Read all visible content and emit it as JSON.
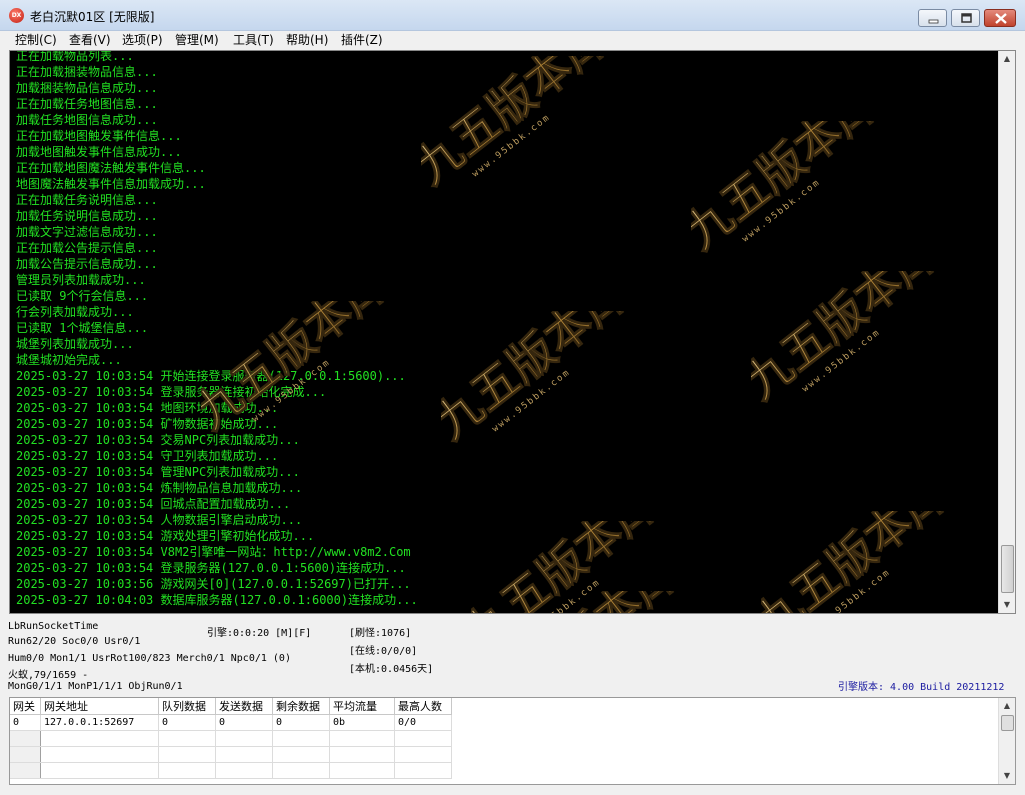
{
  "window": {
    "title": "老白沉默01区 [无限版]",
    "icon_text": "DX",
    "icons": {
      "minimize": "minimize-icon",
      "maximize": "maximize-icon",
      "close": "close-icon"
    }
  },
  "menu": [
    {
      "label": "控制(C)"
    },
    {
      "label": "查看(V)"
    },
    {
      "label": "选项(P)"
    },
    {
      "label": "管理(M)"
    },
    {
      "label": "工具(T)"
    },
    {
      "label": "帮助(H)"
    },
    {
      "label": "插件(Z)"
    }
  ],
  "log": {
    "color": "#22e022",
    "lines": [
      "正在加载物品列表...",
      "正在加载捆装物品信息...",
      "加载捆装物品信息成功...",
      "正在加载任务地图信息...",
      "加载任务地图信息成功...",
      "正在加载地图触发事件信息...",
      "加载地图触发事件信息成功...",
      "正在加载地图魔法触发事件信息...",
      "地图魔法触发事件信息加载成功...",
      "正在加载任务说明信息...",
      "加载任务说明信息成功...",
      "加载文字过滤信息成功...",
      "正在加载公告提示信息...",
      "加载公告提示信息成功...",
      "管理员列表加载成功...",
      "已读取 9个行会信息...",
      "行会列表加载成功...",
      "已读取 1个城堡信息...",
      "城堡列表加载成功...",
      "城堡城初始完成...",
      "2025-03-27 10:03:54 开始连接登录服务器(127.0.0.1:5600)...",
      "2025-03-27 10:03:54 登录服务器连接初始化完成...",
      "2025-03-27 10:03:54 地图环境加载成功...",
      "2025-03-27 10:03:54 矿物数据初始成功...",
      "2025-03-27 10:03:54 交易NPC列表加载成功...",
      "2025-03-27 10:03:54 守卫列表加载成功...",
      "2025-03-27 10:03:54 管理NPC列表加载成功...",
      "2025-03-27 10:03:54 炼制物品信息加载成功...",
      "2025-03-27 10:03:54 回城点配置加载成功...",
      "2025-03-27 10:03:54 人物数据引擎启动成功...",
      "2025-03-27 10:03:54 游戏处理引擎初始化成功...",
      "2025-03-27 10:03:54 V8M2引擎唯一网站：http://www.v8m2.Com",
      "2025-03-27 10:03:54 登录服务器(127.0.0.1:5600)连接成功...",
      "2025-03-27 10:03:56 游戏网关[0](127.0.0.1:52697)已打开...",
      "2025-03-27 10:04:03 数据库服务器(127.0.0.1:6000)连接成功..."
    ]
  },
  "watermark": {
    "text": "九五版本库",
    "url": "www.95bbk.com"
  },
  "status": {
    "socket_time": "LbRunSocketTime",
    "run_line": "Run62/20 Soc0/0 Usr0/1",
    "hum_line": "Hum0/0 Mon1/1 UsrRot100/823 Merch0/1 Npc0/1 (0)",
    "item_line": "火蚁,79/1659 -",
    "mon_line": "MonG0/1/1 MonP1/1/1 ObjRun0/1",
    "engine": "引擎:0:0:20 [M][F]",
    "refresh": "[刷怪:1076]",
    "online": "[在线:0/0/0]",
    "local": "[本机:0.0456天]",
    "version": "引擎版本: 4.00 Build 20211212",
    "version_color": "#1a1aa0"
  },
  "gateway_grid": {
    "columns": [
      "网关",
      "网关地址",
      "队列数据",
      "发送数据",
      "剩余数据",
      "平均流量",
      "最高人数"
    ],
    "rows": [
      [
        "0",
        "127.0.0.1:52697",
        "0",
        "0",
        "0",
        "0b",
        "0/0"
      ],
      [
        "",
        "",
        "",
        "",
        "",
        "",
        ""
      ],
      [
        "",
        "",
        "",
        "",
        "",
        "",
        ""
      ],
      [
        "",
        "",
        "",
        "",
        "",
        "",
        ""
      ]
    ]
  }
}
